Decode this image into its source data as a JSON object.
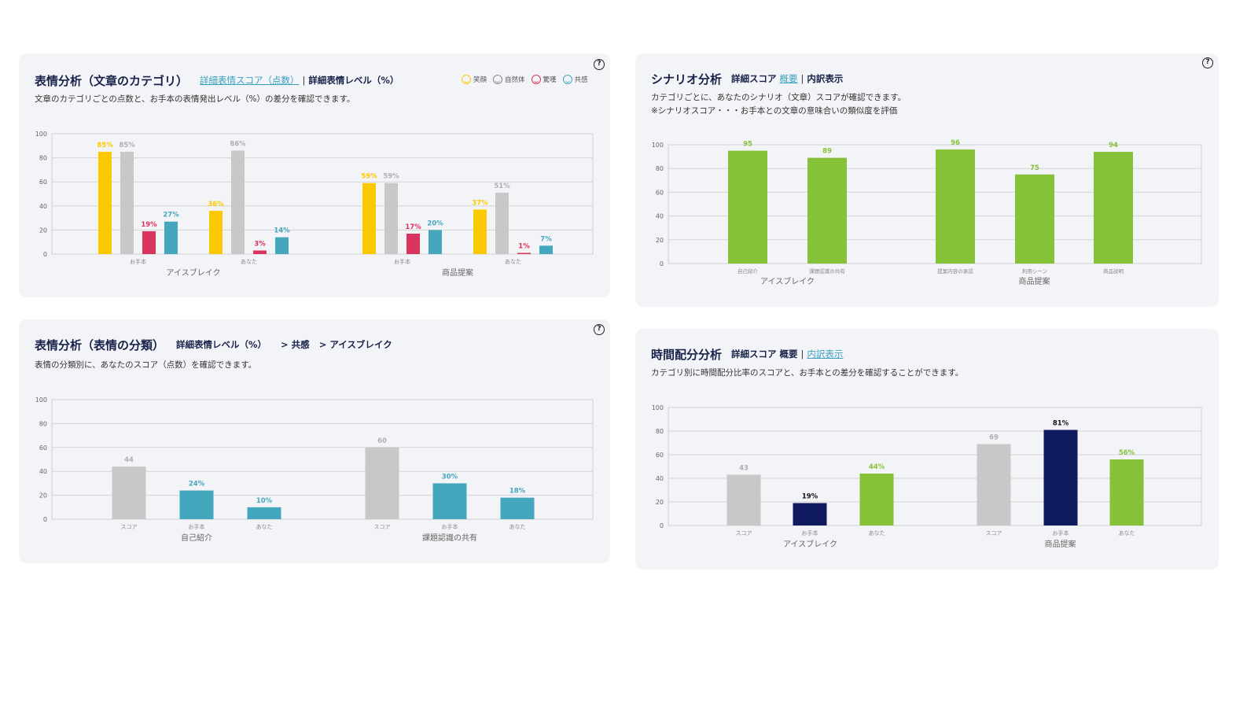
{
  "colors": {
    "yellow": "#fcc800",
    "gray": "#c8c8c8",
    "red": "#d9345d",
    "teal": "#45a7bd",
    "green": "#86c238",
    "navy": "#101a5e",
    "help": "#222222"
  },
  "panel1": {
    "title": "表情分析（文章のカテゴリ）",
    "link_score": "詳細表情スコア（点数）",
    "sep": "|",
    "link_level": "詳細表情レベル（%）",
    "desc": "文章のカテゴリごとの点数と、お手本の表情発出レベル（%）の差分を確認できます。",
    "help_icon": "?",
    "legend": [
      {
        "label": "笑顔",
        "icon": "smile-icon",
        "color": "#fcc800"
      },
      {
        "label": "自然体",
        "icon": "neutral-face-icon",
        "color": "#888888"
      },
      {
        "label": "驚嘆",
        "icon": "surprise-face-icon",
        "color": "#d9345d"
      },
      {
        "label": "共感",
        "icon": "empathy-face-icon",
        "color": "#45a7bd"
      }
    ]
  },
  "panel2": {
    "title": "シナリオ分析",
    "link_detail": "詳細スコア",
    "link_summary": "概要",
    "sep": "|",
    "link_breakdown": "内訳表示",
    "desc_line1": "カテゴリごとに、あなたのシナリオ（文章）スコアが確認できます。",
    "desc_line2": "※シナリオスコア・・・お手本との文章の意味合いの類似度を評価",
    "help_icon": "?"
  },
  "panel3": {
    "title": "表情分析（表情の分類）",
    "crumb1": "詳細表情レベル（%）",
    "crumb2": "> 共感",
    "crumb3": "> アイスブレイク",
    "desc": "表情の分類別に、あなたのスコア（点数）を確認できます。",
    "help_icon": "?"
  },
  "panel4": {
    "title": "時間配分分析",
    "link_detail": "詳細スコア",
    "link_summary": "概要",
    "sep": "|",
    "link_breakdown": "内訳表示",
    "desc": "カテゴリ別に時間配分比率のスコアと、お手本との差分を確認することができます。"
  },
  "chart_data": [
    {
      "type": "bar",
      "ylim": [
        0,
        100
      ],
      "yticks": [
        0,
        20,
        40,
        60,
        80,
        100
      ],
      "grid": true,
      "groups": [
        {
          "label": "アイスブレイク",
          "subgroups": [
            {
              "label": "お手本",
              "bars": [
                {
                  "value": 85,
                  "label": "85%",
                  "color": "yellow"
                },
                {
                  "value": 85,
                  "label": "85%",
                  "color": "gray"
                },
                {
                  "value": 19,
                  "label": "19%",
                  "color": "red"
                },
                {
                  "value": 27,
                  "label": "27%",
                  "color": "teal"
                }
              ]
            },
            {
              "label": "あなた",
              "bars": [
                {
                  "value": 36,
                  "label": "36%",
                  "color": "yellow"
                },
                {
                  "value": 86,
                  "label": "86%",
                  "color": "gray"
                },
                {
                  "value": 3,
                  "label": "3%",
                  "color": "red"
                },
                {
                  "value": 14,
                  "label": "14%",
                  "color": "teal"
                }
              ]
            }
          ]
        },
        {
          "label": "商品提案",
          "subgroups": [
            {
              "label": "お手本",
              "bars": [
                {
                  "value": 59,
                  "label": "59%",
                  "color": "yellow"
                },
                {
                  "value": 59,
                  "label": "59%",
                  "color": "gray"
                },
                {
                  "value": 17,
                  "label": "17%",
                  "color": "red"
                },
                {
                  "value": 20,
                  "label": "20%",
                  "color": "teal"
                }
              ]
            },
            {
              "label": "あなた",
              "bars": [
                {
                  "value": 37,
                  "label": "37%",
                  "color": "yellow"
                },
                {
                  "value": 51,
                  "label": "51%",
                  "color": "gray"
                },
                {
                  "value": 1,
                  "label": "1%",
                  "color": "red"
                },
                {
                  "value": 7,
                  "label": "7%",
                  "color": "teal"
                }
              ]
            }
          ]
        }
      ]
    },
    {
      "type": "bar",
      "ylim": [
        0,
        100
      ],
      "yticks": [
        0,
        20,
        40,
        60,
        80,
        100
      ],
      "grid": true,
      "groups": [
        {
          "label": "アイスブレイク",
          "bars": [
            {
              "cat": "自己紹介",
              "value": 95,
              "label": "95",
              "color": "green"
            },
            {
              "cat": "課題認識の共有",
              "value": 89,
              "label": "89",
              "color": "green"
            }
          ]
        },
        {
          "label": "商品提案",
          "bars": [
            {
              "cat": "提案内容の承認",
              "value": 96,
              "label": "96",
              "color": "green"
            },
            {
              "cat": "利用シーン",
              "value": 75,
              "label": "75",
              "color": "green"
            },
            {
              "cat": "商品説明",
              "value": 94,
              "label": "94",
              "color": "green"
            }
          ]
        }
      ]
    },
    {
      "type": "bar",
      "ylim": [
        0,
        100
      ],
      "yticks": [
        0,
        20,
        40,
        60,
        80,
        100
      ],
      "grid": true,
      "groups": [
        {
          "label": "自己紹介",
          "bars": [
            {
              "cat": "スコア",
              "value": 44,
              "label": "44",
              "color": "gray"
            },
            {
              "cat": "お手本",
              "value": 24,
              "label": "24%",
              "color": "teal"
            },
            {
              "cat": "あなた",
              "value": 10,
              "label": "10%",
              "color": "teal"
            }
          ]
        },
        {
          "label": "課題認識の共有",
          "bars": [
            {
              "cat": "スコア",
              "value": 60,
              "label": "60",
              "color": "gray"
            },
            {
              "cat": "お手本",
              "value": 30,
              "label": "30%",
              "color": "teal"
            },
            {
              "cat": "あなた",
              "value": 18,
              "label": "18%",
              "color": "teal"
            }
          ]
        }
      ]
    },
    {
      "type": "bar",
      "ylim": [
        0,
        100
      ],
      "yticks": [
        0,
        20,
        40,
        60,
        80,
        100
      ],
      "grid": true,
      "groups": [
        {
          "label": "アイスブレイク",
          "bars": [
            {
              "cat": "スコア",
              "value": 43,
              "label": "43",
              "color": "gray"
            },
            {
              "cat": "お手本",
              "value": 19,
              "label": "19%",
              "color": "navy"
            },
            {
              "cat": "あなた",
              "value": 44,
              "label": "44%",
              "color": "green"
            }
          ]
        },
        {
          "label": "商品提案",
          "bars": [
            {
              "cat": "スコア",
              "value": 69,
              "label": "69",
              "color": "gray"
            },
            {
              "cat": "お手本",
              "value": 81,
              "label": "81%",
              "color": "navy"
            },
            {
              "cat": "あなた",
              "value": 56,
              "label": "56%",
              "color": "green"
            }
          ]
        }
      ]
    }
  ]
}
